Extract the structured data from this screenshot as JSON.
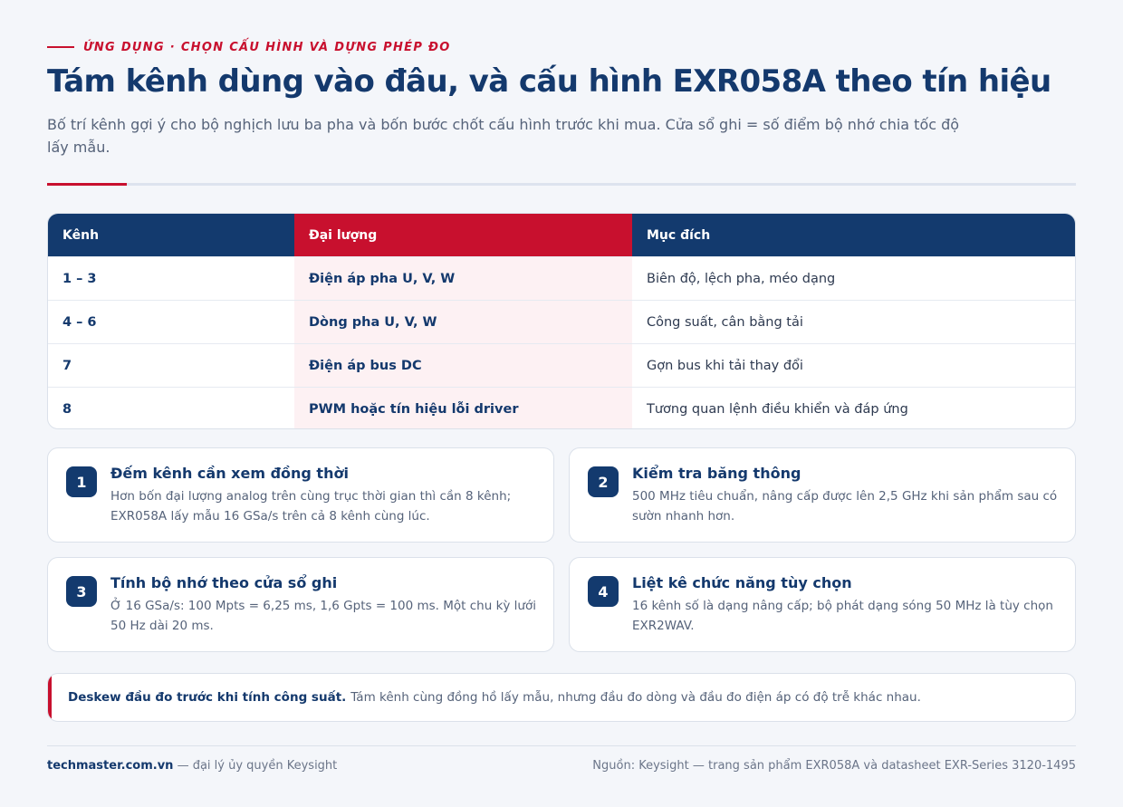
{
  "header": {
    "eyebrow": "ỨNG DỤNG · CHỌN CẤU HÌNH VÀ DỰNG PHÉP ĐO",
    "title": "Tám kênh dùng vào đâu, và cấu hình EXR058A theo tín hiệu",
    "subtitle": "Bố trí kênh gợi ý cho bộ nghịch lưu ba pha và bốn bước chốt cấu hình trước khi mua. Cửa sổ ghi = số điểm bộ nhớ chia tốc độ lấy mẫu."
  },
  "table": {
    "headers": [
      "Kênh",
      "Đại lượng",
      "Mục đích"
    ],
    "rows": [
      {
        "channel": "1 – 3",
        "quantity": "Điện áp pha U, V, W",
        "purpose": "Biên độ, lệch pha, méo dạng"
      },
      {
        "channel": "4 – 6",
        "quantity": "Dòng pha U, V, W",
        "purpose": "Công suất, cân bằng tải"
      },
      {
        "channel": "7",
        "quantity": "Điện áp bus DC",
        "purpose": "Gợn bus khi tải thay đổi"
      },
      {
        "channel": "8",
        "quantity": "PWM hoặc tín hiệu lỗi driver",
        "purpose": "Tương quan lệnh điều khiển và đáp ứng"
      }
    ]
  },
  "steps": [
    {
      "number": "1",
      "title": "Đếm kênh cần xem đồng thời",
      "text": "Hơn bốn đại lượng analog trên cùng trục thời gian thì cần 8 kênh; EXR058A lấy mẫu 16 GSa/s trên cả 8 kênh cùng lúc."
    },
    {
      "number": "2",
      "title": "Kiểm tra băng thông",
      "text": "500 MHz tiêu chuẩn, nâng cấp được lên 2,5 GHz khi sản phẩm sau có sườn nhanh hơn."
    },
    {
      "number": "3",
      "title": "Tính bộ nhớ theo cửa sổ ghi",
      "text": "Ở 16 GSa/s: 100 Mpts = 6,25 ms, 1,6 Gpts = 100 ms. Một chu kỳ lưới 50 Hz dài 20 ms."
    },
    {
      "number": "4",
      "title": "Liệt kê chức năng tùy chọn",
      "text": "16 kênh số là dạng nâng cấp; bộ phát dạng sóng 50 MHz là tùy chọn EXR2WAV."
    }
  ],
  "note": {
    "strong": "Deskew đầu đo trước khi tính công suất.",
    "text": "Tám kênh cùng đồng hồ lấy mẫu, nhưng đầu đo dòng và đầu đo điện áp có độ trễ khác nhau."
  },
  "footer": {
    "brand": "techmaster.com.vn",
    "tagline": "— đại lý ủy quyền Keysight",
    "source": "Nguồn: Keysight — trang sản phẩm EXR058A và datasheet EXR-Series 3120-1495"
  },
  "colors": {
    "accent": "#c8102e",
    "navy": "#133a6e",
    "background": "#f4f6fa"
  }
}
